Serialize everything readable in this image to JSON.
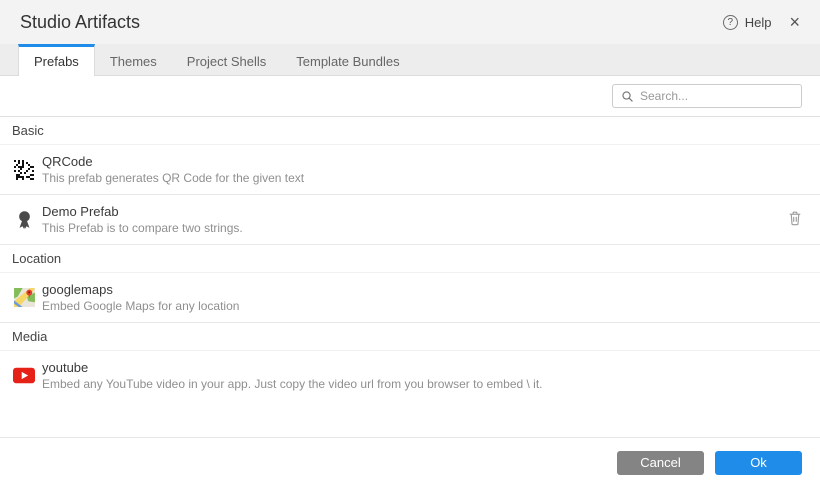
{
  "header": {
    "title": "Studio Artifacts",
    "help_glyph": "?",
    "help_label": "Help",
    "close_glyph": "×"
  },
  "tabs": [
    {
      "label": "Prefabs",
      "active": true
    },
    {
      "label": "Themes",
      "active": false
    },
    {
      "label": "Project Shells",
      "active": false
    },
    {
      "label": "Template Bundles",
      "active": false
    }
  ],
  "search": {
    "placeholder": "Search..."
  },
  "sections": [
    {
      "name": "Basic",
      "items": [
        {
          "icon": "qrcode-icon",
          "title": "QRCode",
          "description": "This prefab generates QR Code for the given text",
          "deletable": false
        },
        {
          "icon": "ribbon-icon",
          "title": "Demo Prefab",
          "description": "This Prefab is to compare two strings.",
          "deletable": true
        }
      ]
    },
    {
      "name": "Location",
      "items": [
        {
          "icon": "googlemaps-icon",
          "title": "googlemaps",
          "description": "Embed Google Maps for any location",
          "deletable": false
        }
      ]
    },
    {
      "name": "Media",
      "items": [
        {
          "icon": "youtube-icon",
          "title": "youtube",
          "description": "Embed any YouTube video in your app. Just copy the video url from you browser to embed \\ it.",
          "deletable": false
        }
      ]
    }
  ],
  "footer": {
    "cancel_label": "Cancel",
    "ok_label": "Ok"
  },
  "colors": {
    "accent": "#1e8ce8",
    "tab_indicator": "#1e8ce8",
    "cancel_button": "#848484",
    "youtube_red": "#e62117",
    "icon_gray": "#4a4a4a"
  }
}
